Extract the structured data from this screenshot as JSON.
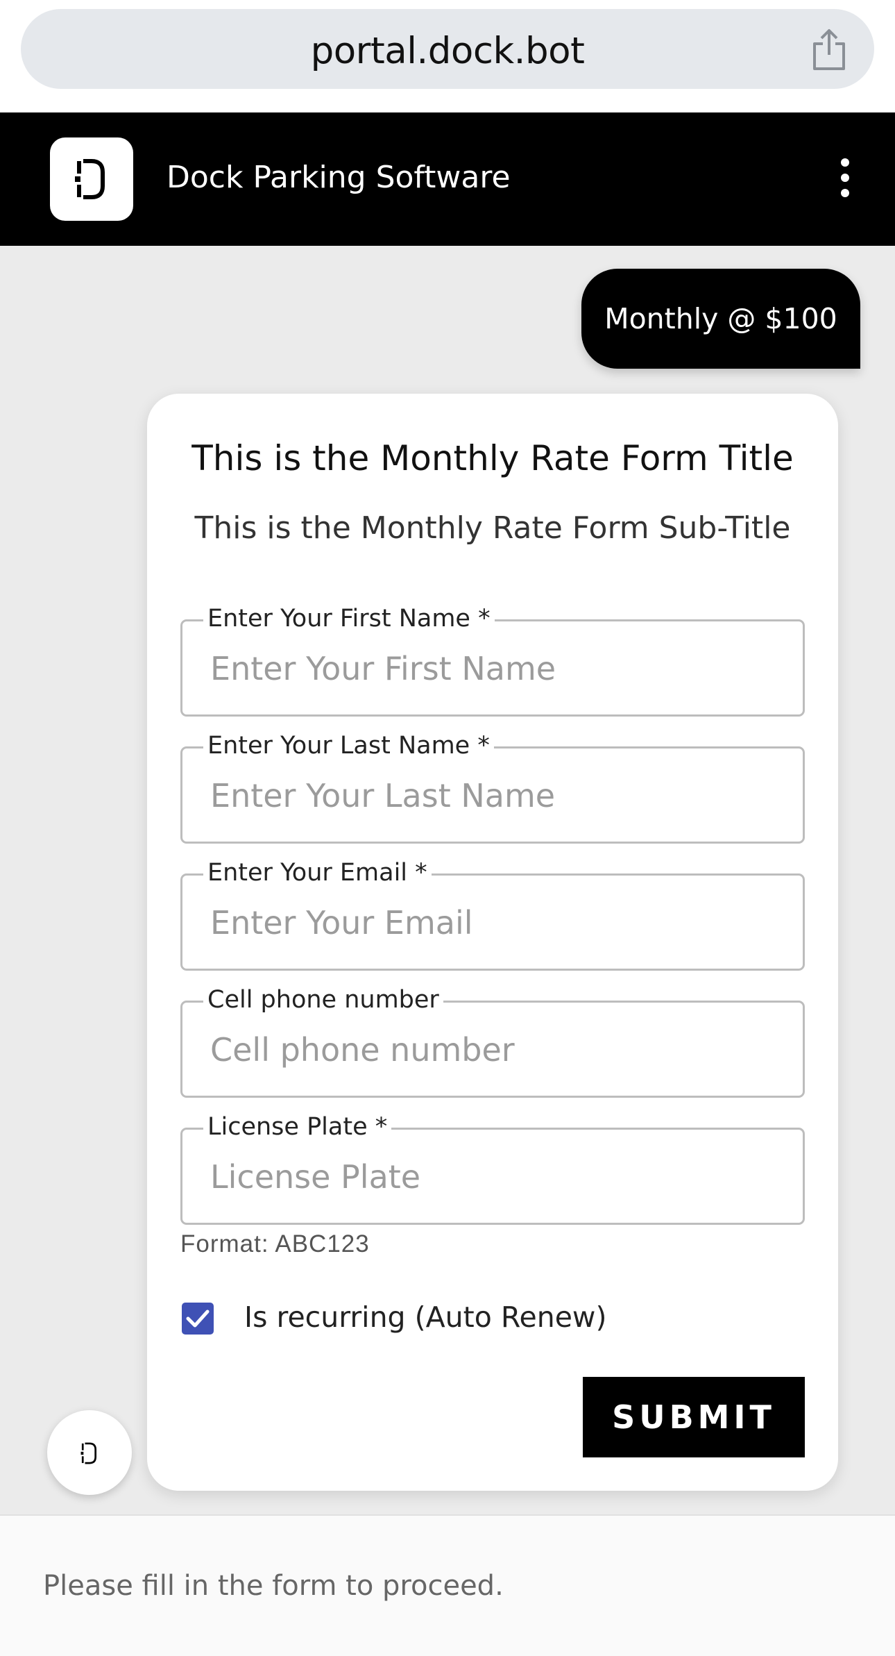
{
  "browser": {
    "url": "portal.dock.bot",
    "share_icon": "share-icon"
  },
  "header": {
    "title": "Dock Parking Software",
    "logo_icon": "dock-logo-icon",
    "menu_icon": "kebab-menu-icon"
  },
  "chat": {
    "user_message": "Monthly @ $100"
  },
  "form": {
    "title": "This is the Monthly Rate Form Title",
    "subtitle": "This is the Monthly Rate Form Sub-Title",
    "fields": [
      {
        "label": "Enter Your First Name *",
        "placeholder": "Enter Your First Name",
        "value": ""
      },
      {
        "label": "Enter Your Last Name *",
        "placeholder": "Enter Your Last Name",
        "value": ""
      },
      {
        "label": "Enter Your Email *",
        "placeholder": "Enter Your Email",
        "value": ""
      },
      {
        "label": "Cell phone number",
        "placeholder": "Cell phone number",
        "value": ""
      },
      {
        "label": "License Plate *",
        "placeholder": "License Plate",
        "value": ""
      }
    ],
    "plate_helper": "Format: ABC123",
    "recurring_label": "Is recurring (Auto Renew)",
    "recurring_checked": true,
    "submit_label": "SUBMIT"
  },
  "footer": {
    "status_text": "Please fill in the form to proceed."
  },
  "colors": {
    "accent": "#3f51b5",
    "header_bg": "#000000",
    "page_bg": "#ebebeb"
  }
}
